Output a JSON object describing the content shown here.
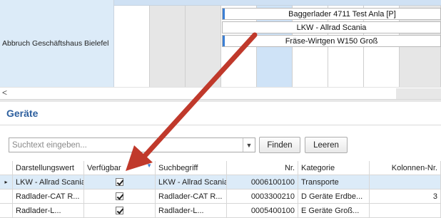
{
  "scheduler": {
    "resource": "Abbruch Geschäftshaus Bielefel",
    "appointments": [
      "Baggerlader 4711 Test Anla [P]",
      "LKW - Allrad Scania",
      "Fräse-Wirtgen W150 Groß"
    ],
    "scroll_left_glyph": "<"
  },
  "panel": {
    "title": "Geräte",
    "search_placeholder": "Suchtext eingeben...",
    "find_label": "Finden",
    "clear_label": "Leeren"
  },
  "grid": {
    "headers": [
      "Darstellungswert",
      "Verfügbar",
      "Suchbegriff",
      "Nr.",
      "Kategorie",
      "Kolonnen-Nr."
    ],
    "rows": [
      {
        "indicator": "▸",
        "display": "LKW - Allrad Scania",
        "search": "LKW - Allrad Scania",
        "nr": "0006100100",
        "category": "Transporte",
        "column_nr": ""
      },
      {
        "indicator": "",
        "display": "Radlader-CAT R...",
        "search": "Radlader-CAT R...",
        "nr": "0003300210",
        "category": "D Geräte Erdbe...",
        "column_nr": "3"
      },
      {
        "indicator": "",
        "display": "Radlader-L...",
        "search": "Radlader-L...",
        "nr": "0005400100",
        "category": "E Geräte Groß...",
        "column_nr": ""
      }
    ]
  },
  "colors": {
    "accent": "#2d5f9e",
    "selection": "#dcebf8",
    "arrow": "#c0392b"
  }
}
